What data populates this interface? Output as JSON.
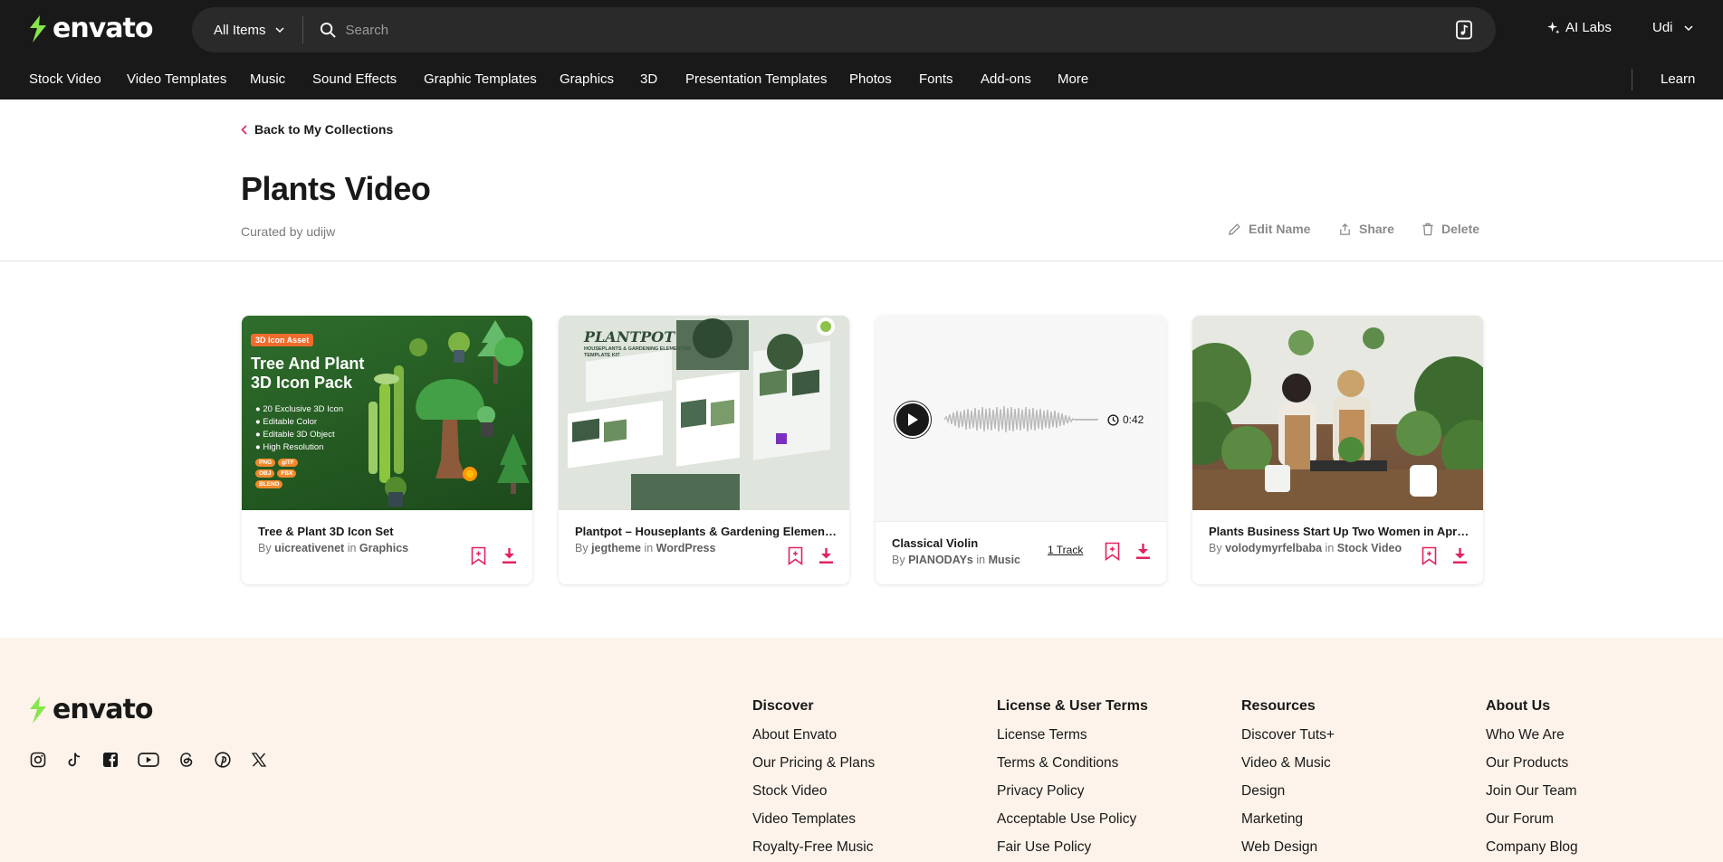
{
  "brand": {
    "name": "envato",
    "accent": "#87e64b",
    "pink": "#e0245e"
  },
  "header": {
    "category_select": "All Items",
    "search_placeholder": "Search",
    "ai_labs": "AI Labs",
    "user": "Udi"
  },
  "nav": {
    "items": [
      "Stock Video",
      "Video Templates",
      "Music",
      "Sound Effects",
      "Graphic Templates",
      "Graphics",
      "3D",
      "Presentation Templates",
      "Photos",
      "Fonts",
      "Add-ons",
      "More"
    ],
    "learn": "Learn"
  },
  "collection": {
    "back": "Back to My Collections",
    "title": "Plants Video",
    "curated": "Curated by udijw",
    "actions": {
      "edit": "Edit Name",
      "share": "Share",
      "delete": "Delete"
    }
  },
  "cards": [
    {
      "title": "Tree & Plant 3D Icon Set",
      "author": "uicreativenet",
      "category": "Graphics",
      "thumb": {
        "badge": "3D Icon Asset",
        "heading1": "Tree And Plant",
        "heading2": "3D Icon Pack",
        "bullets": [
          "20 Exclusive 3D Icon",
          "Editable Color",
          "Editable 3D Object",
          "High Resolution"
        ],
        "formats": [
          "PNG",
          "glTF",
          "OBJ",
          "FBX",
          "BLEND"
        ]
      }
    },
    {
      "title": "Plantpot – Houseplants & Gardening Element...",
      "author": "jegtheme",
      "category": "WordPress",
      "thumb": {
        "logo": "PLANTPOT",
        "subtitle": "HOUSEPLANTS & GARDENING ELEMENTOR TEMPLATE KIT"
      }
    },
    {
      "title": "Classical Violin",
      "author": "PIANODAYs",
      "category": "Music",
      "duration": "0:42",
      "tracks": "1 Track"
    },
    {
      "title": "Plants Business Start Up Two Women in Apro...",
      "author": "volodymyrfelbaba",
      "category": "Stock Video"
    }
  ],
  "by_word": "By",
  "in_word": "in",
  "footer": {
    "columns": [
      {
        "head": "Discover",
        "links": [
          "About Envato",
          "Our Pricing & Plans",
          "Stock Video",
          "Video Templates",
          "Royalty-Free Music"
        ]
      },
      {
        "head": "License & User Terms",
        "links": [
          "License Terms",
          "Terms & Conditions",
          "Privacy Policy",
          "Acceptable Use Policy",
          "Fair Use Policy"
        ]
      },
      {
        "head": "Resources",
        "links": [
          "Discover Tuts+",
          "Video & Music",
          "Design",
          "Marketing",
          "Web Design"
        ]
      },
      {
        "head": "About Us",
        "links": [
          "Who We Are",
          "Our Products",
          "Join Our Team",
          "Our Forum",
          "Company Blog"
        ]
      }
    ],
    "socials": [
      "instagram-icon",
      "tiktok-icon",
      "facebook-icon",
      "youtube-icon",
      "threads-icon",
      "pinterest-icon",
      "x-icon"
    ]
  }
}
